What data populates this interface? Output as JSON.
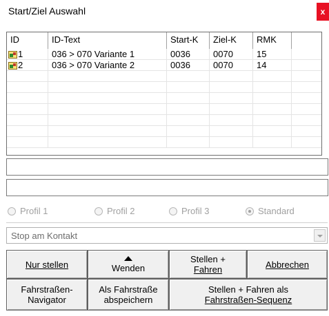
{
  "window": {
    "title": "Start/Ziel Auswahl",
    "close_glyph": "x"
  },
  "grid": {
    "columns": [
      "ID",
      "ID-Text",
      "Start-K",
      "Ziel-K",
      "RMK"
    ],
    "rows": [
      {
        "id": "1",
        "text": "036 > 070 Variante 1",
        "start": "0036",
        "ziel": "0070",
        "rmk": "15",
        "icon": "route-icon"
      },
      {
        "id": "2",
        "text": "036 > 070 Variante 2",
        "start": "0036",
        "ziel": "0070",
        "rmk": "14",
        "icon": "route-icon"
      }
    ]
  },
  "fields": {
    "field1_value": "",
    "field2_value": ""
  },
  "profiles": {
    "options": [
      "Profil 1",
      "Profil 2",
      "Profil 3",
      "Standard"
    ],
    "selected": "Standard",
    "enabled": false
  },
  "stop_mode": {
    "selected": "Stop am Kontakt"
  },
  "buttons": {
    "nur_stellen": "Nur stellen",
    "wenden": "Wenden",
    "stellen_fahren_line1": "Stellen +",
    "stellen_fahren_line2": "Fahren",
    "abbrechen": "Abbrechen",
    "navigator_line1": "Fahrstraßen-",
    "navigator_line2": "Navigator",
    "speichern_line1": "Als Fahrstraße",
    "speichern_line2": "abspeichern",
    "sequenz_line1": "Stellen + Fahren als",
    "sequenz_line2": "Fahrstraßen-Sequenz"
  },
  "colors": {
    "close_red": "#e81123",
    "button_face": "#f0f0f0",
    "disabled_text": "#a0a0a0"
  }
}
